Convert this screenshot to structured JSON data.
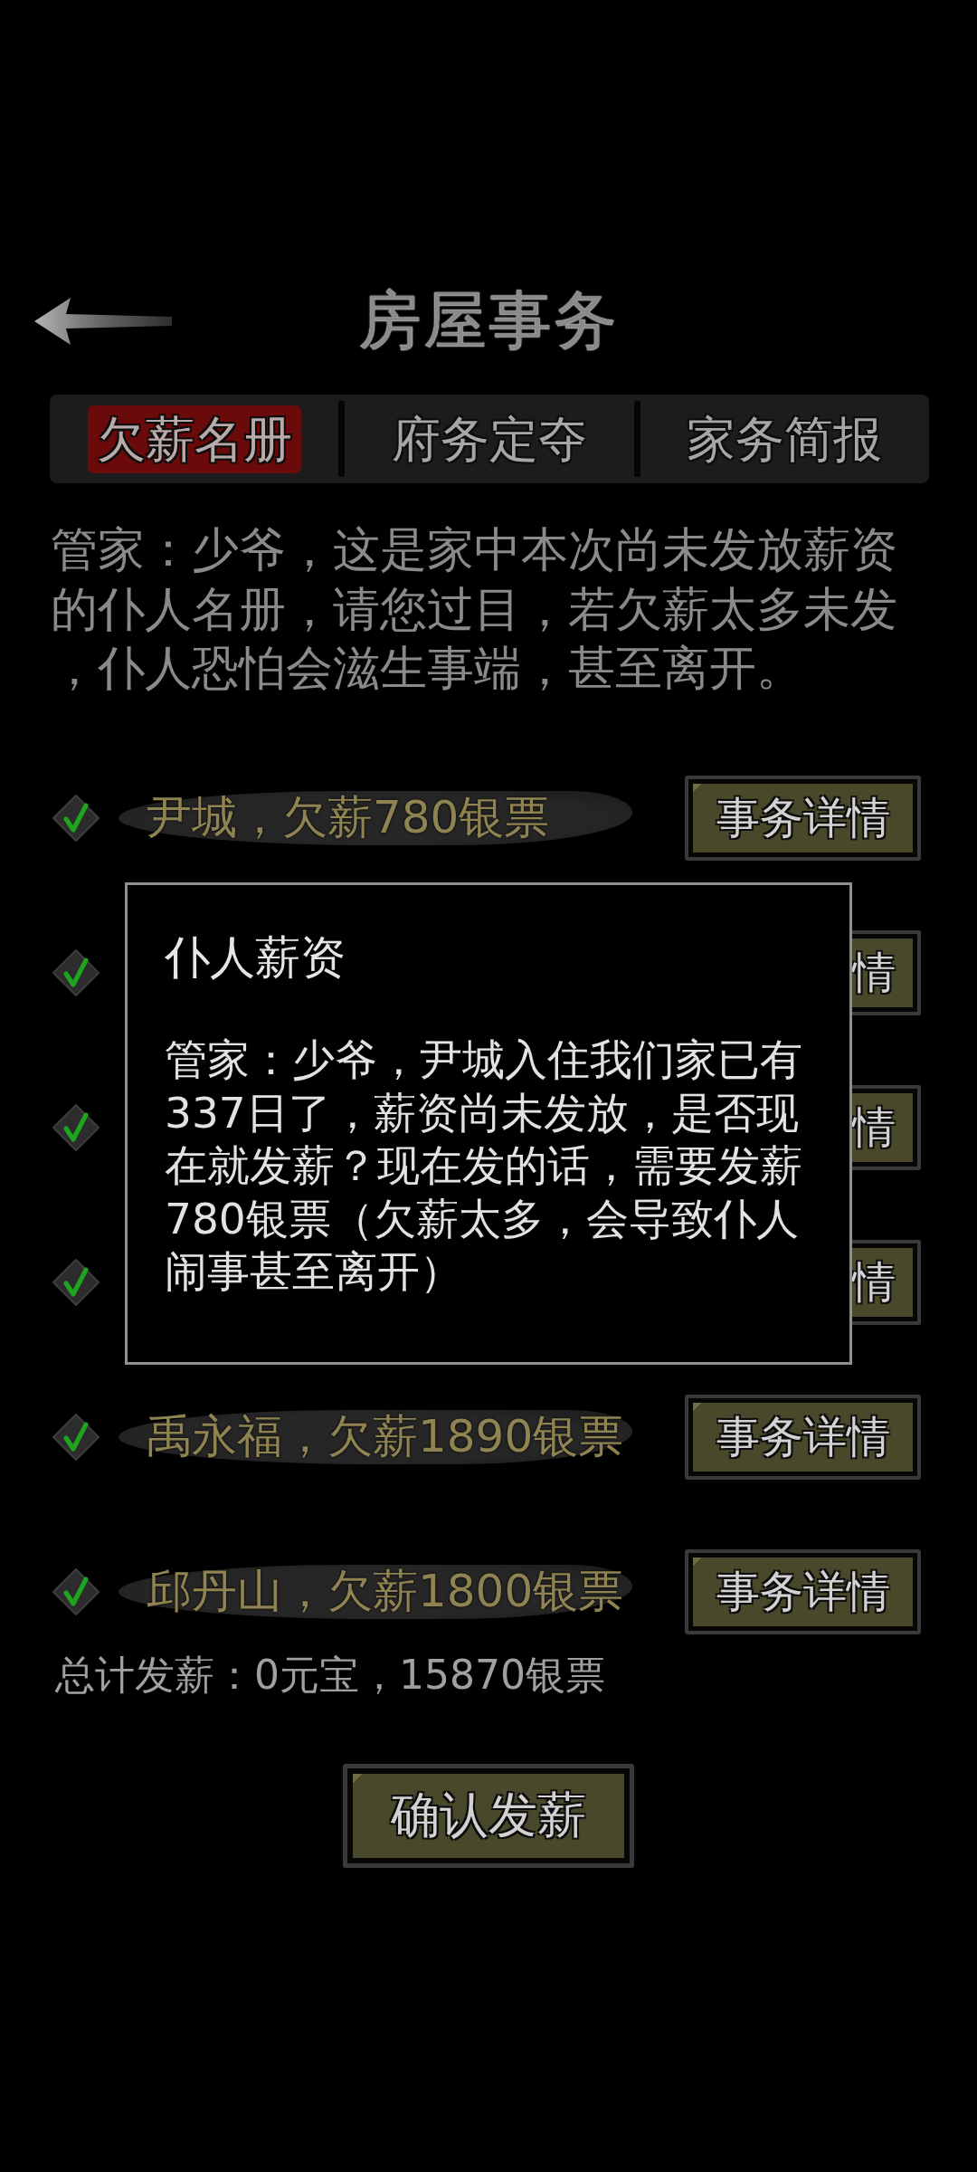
{
  "header": {
    "title": "房屋事务"
  },
  "tabs": [
    {
      "label": "欠薪名册",
      "selected": true
    },
    {
      "label": "府务定夺",
      "selected": false
    },
    {
      "label": "家务简报",
      "selected": false
    }
  ],
  "intro": "管家：少爷，这是家中本次尚未发放薪资的仆人名册，请您过目，若欠薪太多未发，仆人恐怕会滋生事端，甚至离开。",
  "rows": [
    {
      "kind": "full",
      "checked": true,
      "label": "尹城，欠薪780银票",
      "button": "事务详情"
    },
    {
      "kind": "covered",
      "checked": true,
      "button": "情"
    },
    {
      "kind": "covered",
      "checked": true,
      "button": "情"
    },
    {
      "kind": "covered",
      "checked": true,
      "button": "情"
    },
    {
      "kind": "full",
      "checked": true,
      "label": "禹永福，欠薪1890银票",
      "button": "事务详情"
    },
    {
      "kind": "full",
      "checked": true,
      "label": "邱丹山，欠薪1800银票",
      "button": "事务详情"
    }
  ],
  "total": "总计发薪：0元宝，15870银票",
  "confirm_button": "确认发薪",
  "dialog": {
    "title": "仆人薪资",
    "body": "管家：少爷，尹城入住我们家已有337日了，薪资尚未发放，是否现在就发薪？现在发的话，需要发薪780银票（欠薪太多，会导致仆人闹事甚至离开）"
  }
}
